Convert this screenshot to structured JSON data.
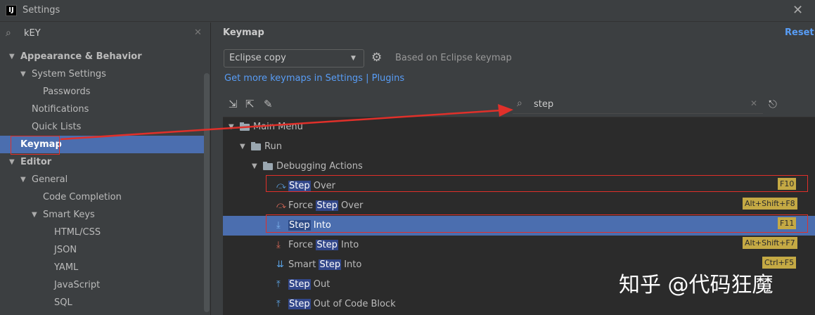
{
  "window": {
    "title": "Settings",
    "app_icon": "IJ"
  },
  "left": {
    "search_value": "kEY",
    "tree": [
      {
        "label": "Appearance & Behavior",
        "bold": true
      },
      {
        "label": "System Settings"
      },
      {
        "label": "Passwords"
      },
      {
        "label": "Notifications"
      },
      {
        "label": "Quick Lists"
      },
      {
        "label": "Keymap",
        "bold": true
      },
      {
        "label": "Editor",
        "bold": true
      },
      {
        "label": "General"
      },
      {
        "label": "Code Completion"
      },
      {
        "label": "Smart Keys"
      },
      {
        "label": "HTML/CSS"
      },
      {
        "label": "JSON"
      },
      {
        "label": "YAML"
      },
      {
        "label": "JavaScript"
      },
      {
        "label": "SQL"
      }
    ]
  },
  "right": {
    "title": "Keymap",
    "reset_label": "Reset",
    "keymap_select": "Eclipse copy",
    "based_on": "Based on Eclipse keymap",
    "get_more_link": "Get more keymaps in Settings | Plugins",
    "filter_value": "step",
    "tree": {
      "main_menu": "Main Menu",
      "run": "Run",
      "debugging_actions": "Debugging Actions",
      "actions": [
        {
          "pre": "",
          "hl": "Step",
          "post": " Over",
          "shortcut": "F10"
        },
        {
          "pre": "Force ",
          "hl": "Step",
          "post": " Over",
          "shortcut": "Alt+Shift+F8"
        },
        {
          "pre": "",
          "hl": "Step",
          "post": " Into",
          "shortcut": "F11"
        },
        {
          "pre": "Force ",
          "hl": "Step",
          "post": " Into",
          "shortcut": "Alt+Shift+F7"
        },
        {
          "pre": "Smart ",
          "hl": "Step",
          "post": " Into",
          "shortcut": "Ctrl+F5"
        },
        {
          "pre": "",
          "hl": "Step",
          "post": " Out",
          "shortcut": ""
        },
        {
          "pre": "",
          "hl": "Step",
          "post": " Out of Code Block",
          "shortcut": ""
        }
      ]
    }
  },
  "watermark": "知乎 @代码狂魔",
  "colors": {
    "selection": "#4b6eaf",
    "link": "#589df6",
    "annotation": "#e0302a",
    "shortcut_badge": "#c4a944"
  }
}
